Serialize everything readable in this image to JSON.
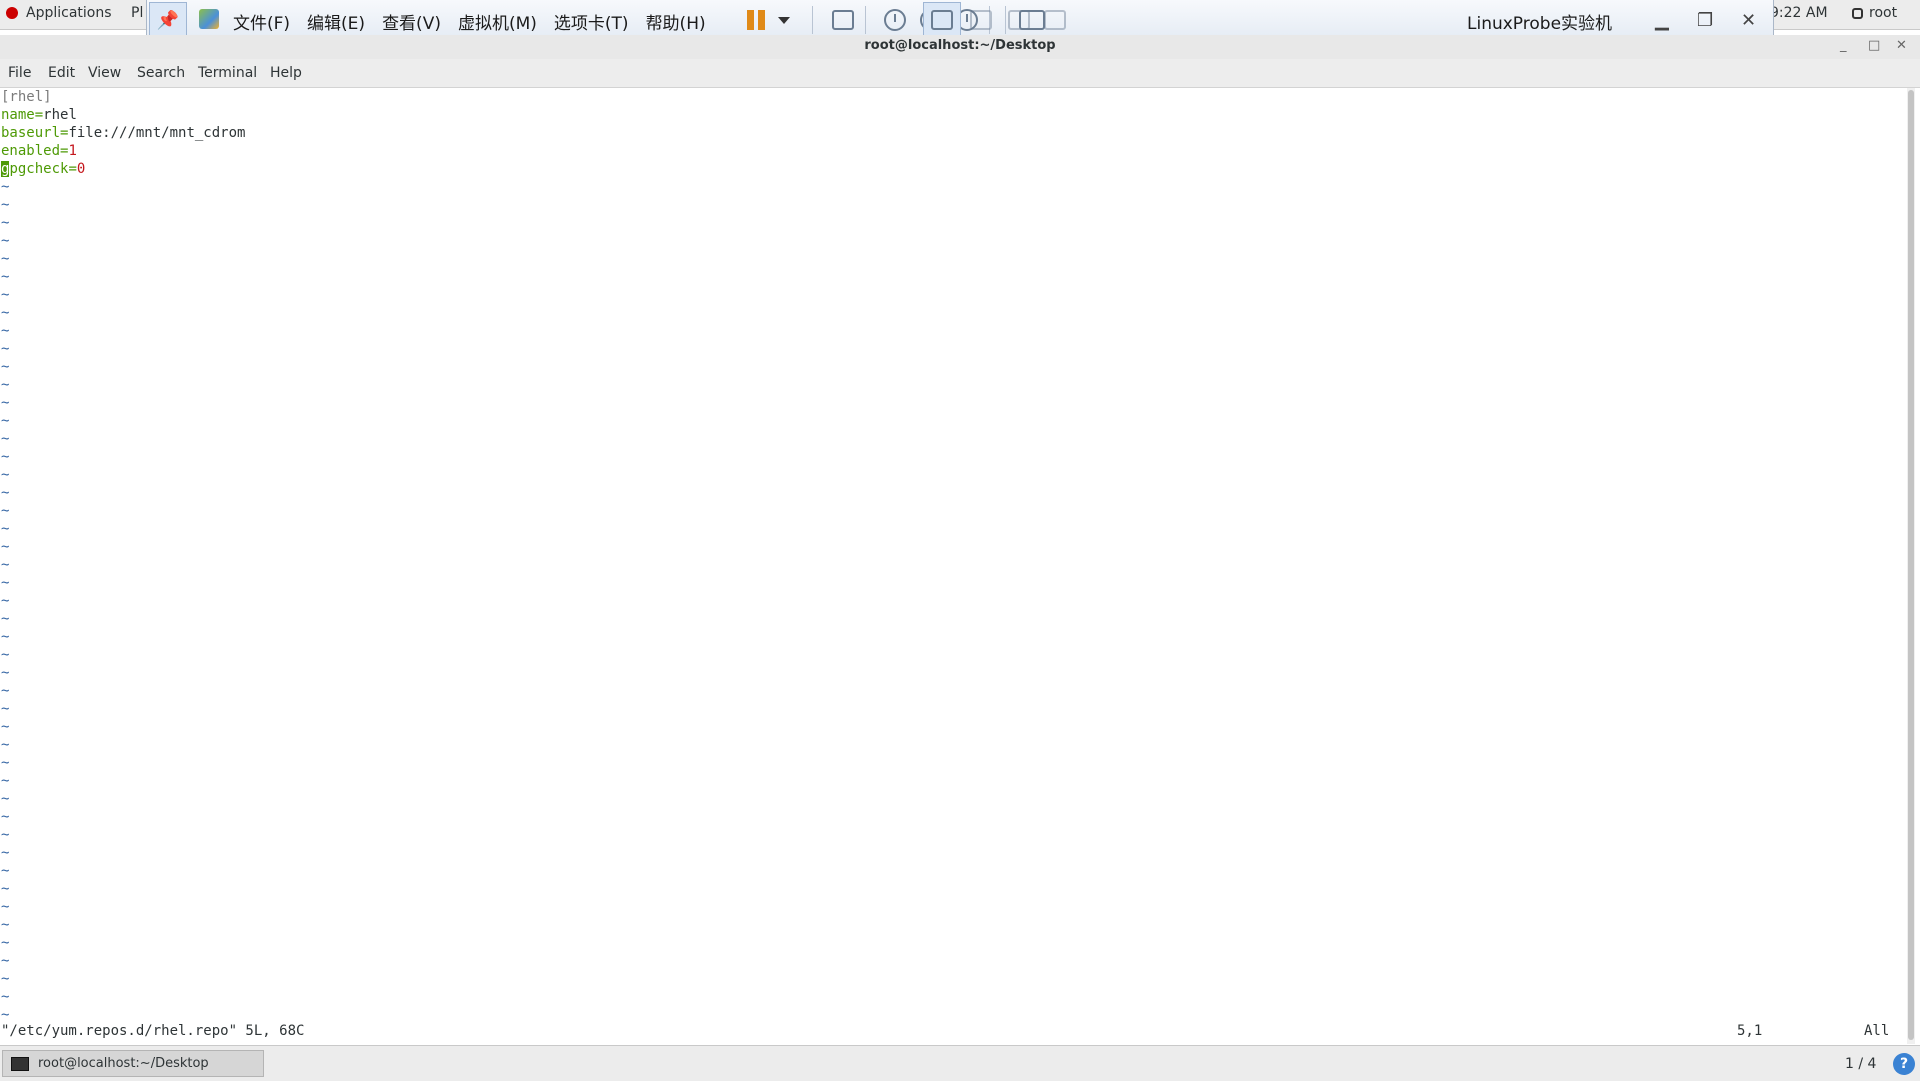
{
  "top_bar": {
    "applications_label": "Applications",
    "places_label": "Pl",
    "clock": "9:22 AM",
    "user": "root"
  },
  "vm_toolbar": {
    "menu": [
      "文件(F)",
      "编辑(E)",
      "查看(V)",
      "虚拟机(M)",
      "选项卡(T)",
      "帮助(H)"
    ],
    "vm_name": "LinuxProbe实验机"
  },
  "terminal": {
    "window_title": "root@localhost:~/Desktop",
    "menu": [
      "File",
      "Edit",
      "View",
      "Search",
      "Terminal",
      "Help"
    ],
    "lines": {
      "section": "[rhel]",
      "name_key": "name=",
      "name_val": "rhel",
      "baseurl_key": "baseurl=",
      "baseurl_val": "file:///mnt/mnt_cdrom",
      "enabled_key": "enabled=",
      "enabled_val": "1",
      "gpg_cursor": "g",
      "gpg_key": "pgcheck=",
      "gpg_val": "0"
    },
    "tilde": "~",
    "status_file": "\"/etc/yum.repos.d/rhel.repo\" 5L, 68C",
    "status_position": "5,1",
    "status_scroll": "All"
  },
  "taskbar": {
    "task_label": "root@localhost:~/Desktop",
    "workspace": "1 / 4",
    "help": "?"
  }
}
